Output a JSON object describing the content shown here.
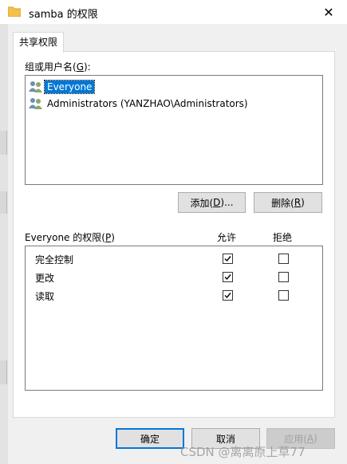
{
  "window": {
    "title": "samba 的权限",
    "close_symbol": "✕"
  },
  "tab": {
    "label": "共享权限"
  },
  "group_section": {
    "label": "组或用户名(G):",
    "label_prefix": "组或用户名(",
    "label_key": "G",
    "label_suffix": "):"
  },
  "users": [
    {
      "name": "Everyone",
      "selected": true,
      "icon": "user-group-icon"
    },
    {
      "name": "Administrators (YANZHAO\\Administrators)",
      "selected": false,
      "icon": "user-group-icon"
    }
  ],
  "buttons": {
    "add": {
      "prefix": "添加(",
      "key": "D",
      "suffix": ")..."
    },
    "remove": {
      "prefix": "删除(",
      "key": "R",
      "suffix": ")"
    },
    "ok": "确定",
    "cancel": "取消",
    "apply": {
      "prefix": "应用(",
      "key": "A",
      "suffix": ")"
    }
  },
  "permissions": {
    "label_prefix": "Everyone 的权限(",
    "label_key": "P",
    "label_suffix": ")",
    "allow_header": "允许",
    "deny_header": "拒绝",
    "rows": [
      {
        "name": "完全控制",
        "allow": true,
        "deny": false
      },
      {
        "name": "更改",
        "allow": true,
        "deny": false
      },
      {
        "name": "读取",
        "allow": true,
        "deny": false
      }
    ]
  },
  "watermark": "CSDN @离离原上草77",
  "colors": {
    "selection": "#0078d7",
    "folder": "#f3c04a",
    "default_button_border": "#0078d7"
  }
}
